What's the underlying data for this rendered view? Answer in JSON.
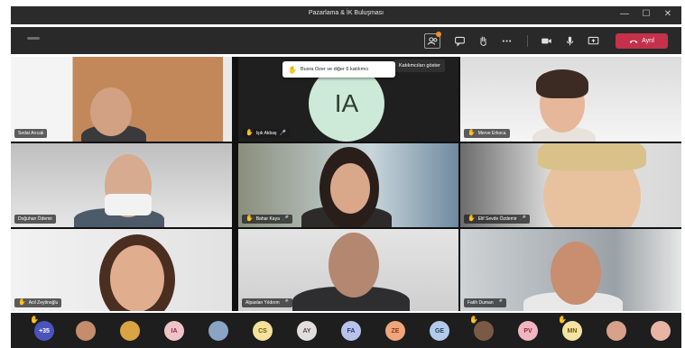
{
  "window": {
    "title": "Pazarlama & İK Buluşması"
  },
  "toolbar": {
    "leave_label": "Ayrıl",
    "participants_tooltip": "Katılımcıları göster"
  },
  "banner": {
    "text": "Busra Ozer ve diğer 6 katılımcı"
  },
  "tiles": [
    {
      "name": "Sedat Arıcak",
      "hand": false,
      "mic": false
    },
    {
      "name": "Işık Akbaş",
      "hand": true,
      "mic": true,
      "initials": "IA"
    },
    {
      "name": "Merve Erkoca",
      "hand": true,
      "mic": false
    },
    {
      "name": "Doğuhan Ödemir",
      "hand": false,
      "mic": false
    },
    {
      "name": "Bahar Kaya",
      "hand": true,
      "mic": true
    },
    {
      "name": "Elif Sevde Özdemir",
      "hand": true,
      "mic": true
    },
    {
      "name": "Acil Zeytinoğlu",
      "hand": true,
      "mic": false
    },
    {
      "name": "Alpaslan Yıldırım",
      "hand": false,
      "mic": true
    },
    {
      "name": "Fatih Duman",
      "hand": false,
      "mic": true
    }
  ],
  "strip": [
    {
      "label": "+35",
      "bg": "#4b53bc",
      "fg": "#ffffff",
      "hand": true
    },
    {
      "label": "",
      "bg": "#c58d6b",
      "photo": true
    },
    {
      "label": "",
      "bg": "#d9a441",
      "photo": true
    },
    {
      "label": "IA",
      "bg": "#f0c3c9",
      "fg": "#8e2b3b"
    },
    {
      "label": "",
      "bg": "#8aa4c4",
      "photo": true
    },
    {
      "label": "CS",
      "bg": "#f5e19b",
      "fg": "#6d5a0b"
    },
    {
      "label": "AY",
      "bg": "#e3dede",
      "fg": "#5a4a4a"
    },
    {
      "label": "FA",
      "bg": "#b9c3ea",
      "fg": "#28367a"
    },
    {
      "label": "ZE",
      "bg": "#f0a57c",
      "fg": "#8a3a12"
    },
    {
      "label": "GE",
      "bg": "#b3cbe8",
      "fg": "#24406b"
    },
    {
      "label": "",
      "bg": "#7a5a45",
      "photo": true,
      "hand": true
    },
    {
      "label": "PV",
      "bg": "#f2b6c0",
      "fg": "#8e2b3b"
    },
    {
      "label": "MN",
      "bg": "#f4e3a3",
      "fg": "#6d5a0b",
      "hand": true
    },
    {
      "label": "",
      "bg": "#d7a18a",
      "photo": true
    },
    {
      "label": "",
      "bg": "#e8b5a5",
      "photo": true
    }
  ],
  "colors": {
    "accent_leave": "#c4314b",
    "raised_hand": "#f3b619",
    "notification_badge": "#ef8e2b"
  }
}
